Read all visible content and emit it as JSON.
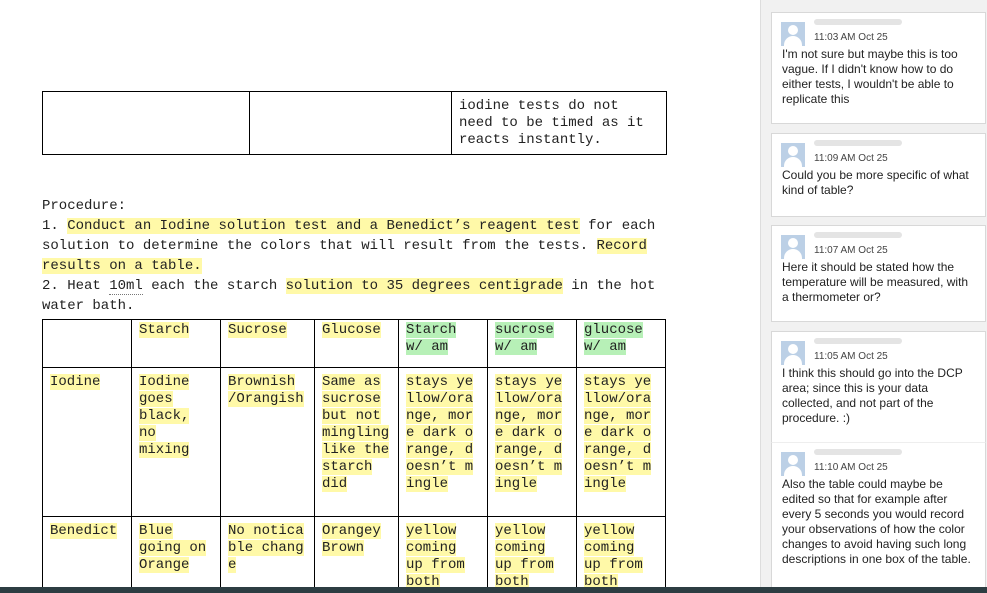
{
  "top_table": {
    "cells": [
      "",
      "",
      "iodine tests do not need to be timed as it reacts instantly."
    ]
  },
  "procedure": {
    "heading": "Procedure:",
    "step1_num": "1. ",
    "step1_hl1": "Conduct an Iodine solution test and a Benedict’s reagent test",
    "step1_mid": " for each solution to determine the colors that will result from the tests. ",
    "step1_hl2": "Record results on a table.",
    "step2_num": "2. Heat ",
    "step2_underline": "10ml",
    "step2_mid": " each the starch ",
    "step2_hl": "solution to 35 degrees centigrade",
    "step2_end": " in the hot water bath."
  },
  "results_table": {
    "headers": [
      "",
      "Starch",
      "Sucrose",
      "Glucose",
      "Starch w/ am",
      "sucrose w/ am",
      "glucose w/ am"
    ],
    "rows": [
      {
        "label": "Iodine",
        "cells": [
          "Iodine goes black, no mixing",
          "Brownish /Orangish",
          "Same as sucrose but not mingling like the starch did",
          "stays yellow/orange, more dark orange, doesn’t mingle",
          "stays yellow/orange, more dark orange, doesn’t mingle",
          "stays yellow/orange, more dark orange, doesn’t mingle"
        ]
      },
      {
        "label": "Benedict",
        "cells": [
          "Blue going on Orange",
          "No noticable change",
          "Orangey Brown",
          "yellow coming up from both",
          "yellow coming up from both",
          "yellow coming up from both"
        ]
      }
    ]
  },
  "comments": [
    {
      "time": "11:03 AM Oct 25",
      "text": "I'm not sure but maybe this is too vague. If I didn't know how to do either tests, I wouldn't be able to replicate this"
    },
    {
      "time": "11:09 AM Oct 25",
      "text": "Could you be more specific of what kind of table?"
    },
    {
      "time": "11:07 AM Oct 25",
      "text": "Here it should be stated how the temperature will be measured, with a thermometer or?"
    },
    {
      "time": "11:05 AM Oct 25",
      "text": "I think this should go into the DCP area; since this is your data collected, and not part of the procedure. :)"
    },
    {
      "time": "11:10 AM Oct 25",
      "text": "Also the table could maybe be edited so that for example after every 5 seconds you would record your observations of how the color changes to avoid having such long descriptions in one box of the table."
    }
  ],
  "colors": {
    "highlight_yellow": "#fff9a8",
    "highlight_green": "#b7f0b7",
    "sidebar_bg": "#f1f1f1"
  }
}
